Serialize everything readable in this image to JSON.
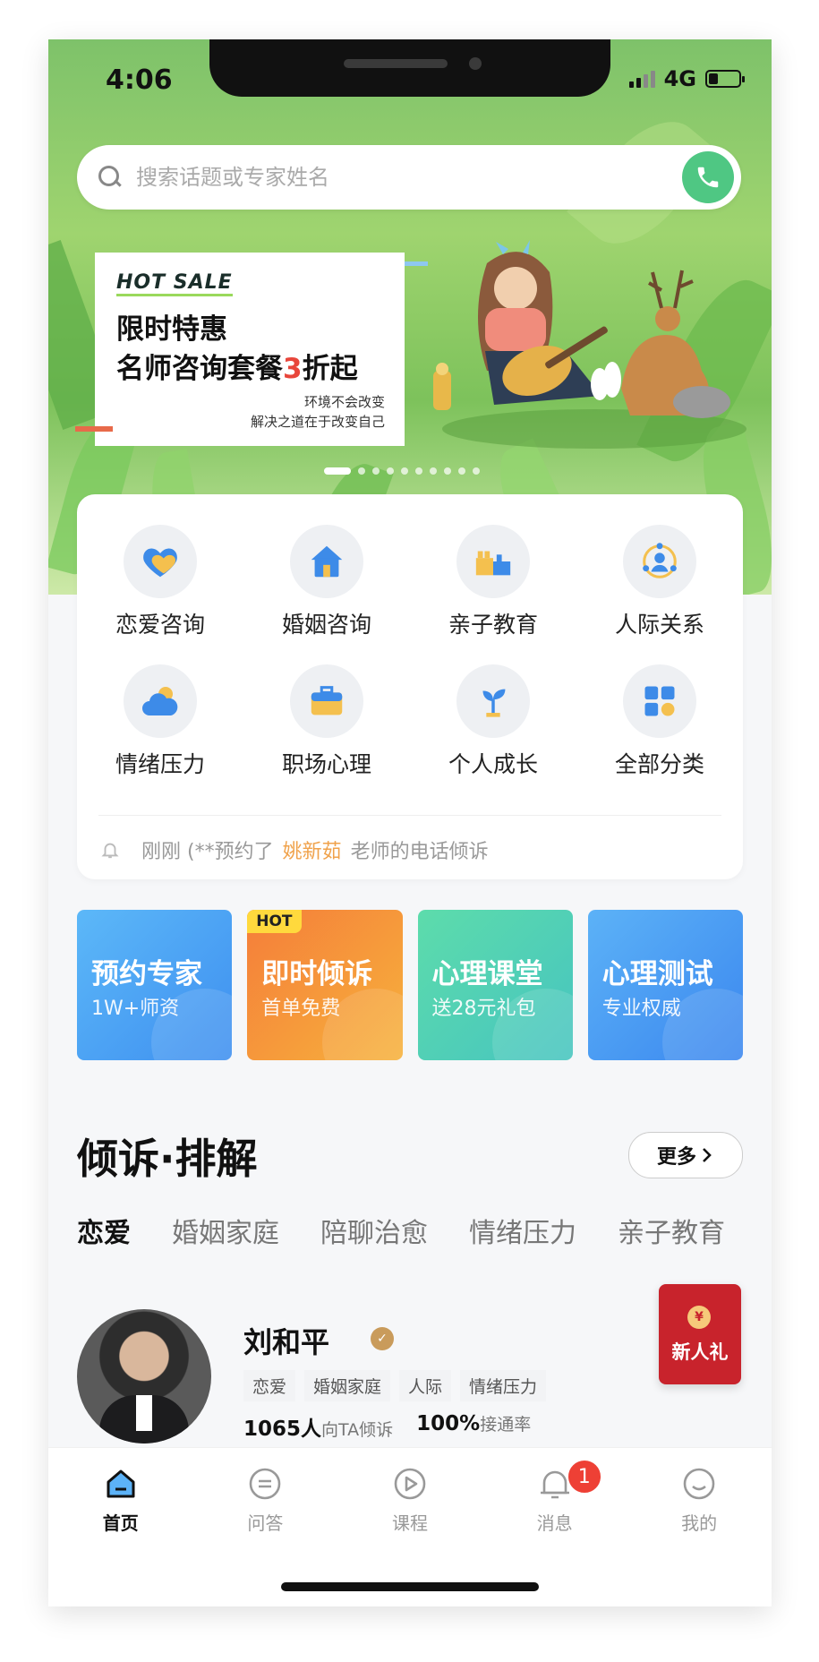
{
  "status": {
    "time": "4:06",
    "network": "4G"
  },
  "search": {
    "placeholder": "搜索话题或专家姓名"
  },
  "banner": {
    "hot_sale": "HOT SALE",
    "line1": "限时特惠",
    "line2_pre": "名师咨询套餐",
    "line2_num": "3",
    "line2_post": "折起",
    "sub1": "环境不会改变",
    "sub2": "解决之道在于改变自己"
  },
  "categories": [
    {
      "label": "恋爱咨询",
      "icon": "heart-icon"
    },
    {
      "label": "婚姻咨询",
      "icon": "house-icon"
    },
    {
      "label": "亲子教育",
      "icon": "blocks-icon"
    },
    {
      "label": "人际关系",
      "icon": "people-icon"
    },
    {
      "label": "情绪压力",
      "icon": "cloud-sun-icon"
    },
    {
      "label": "职场心理",
      "icon": "briefcase-icon"
    },
    {
      "label": "个人成长",
      "icon": "sprout-icon"
    },
    {
      "label": "全部分类",
      "icon": "grid-icon"
    }
  ],
  "notice": {
    "prefix": "刚刚 (**预约了",
    "name": "姚新茹",
    "suffix": "老师的电话倾诉"
  },
  "features": [
    {
      "title": "预约专家",
      "sub": "1W+师资",
      "color_from": "#5cb8f8",
      "color_to": "#3e8ff0",
      "hot": ""
    },
    {
      "title": "即时倾诉",
      "sub": "首单免费",
      "color_from": "#f6a13c",
      "color_to": "#f57d3a",
      "hot": "HOT"
    },
    {
      "title": "心理课堂",
      "sub": "送28元礼包",
      "color_from": "#5ddcab",
      "color_to": "#46c4c0",
      "hot": ""
    },
    {
      "title": "心理测试",
      "sub": "专业权威",
      "color_from": "#5cb2f7",
      "color_to": "#3b87ef",
      "hot": ""
    }
  ],
  "section": {
    "title": "倾诉·排解",
    "more": "更多"
  },
  "tabs": [
    "恋爱",
    "婚姻家庭",
    "陪聊治愈",
    "情绪压力",
    "亲子教育"
  ],
  "expert": {
    "name": "刘和平",
    "tags": [
      "恋爱",
      "婚姻家庭",
      "人际",
      "情绪压力"
    ],
    "count": "1065人",
    "count_label": "向TA倾诉",
    "rate": "100%",
    "rate_label": "接通率"
  },
  "gift": {
    "label": "新人礼",
    "coin": "¥"
  },
  "tabbar": [
    {
      "label": "首页",
      "icon": "home-icon"
    },
    {
      "label": "问答",
      "icon": "chat-icon"
    },
    {
      "label": "课程",
      "icon": "play-icon"
    },
    {
      "label": "消息",
      "icon": "bell-icon",
      "badge": "1"
    },
    {
      "label": "我的",
      "icon": "profile-icon"
    }
  ]
}
